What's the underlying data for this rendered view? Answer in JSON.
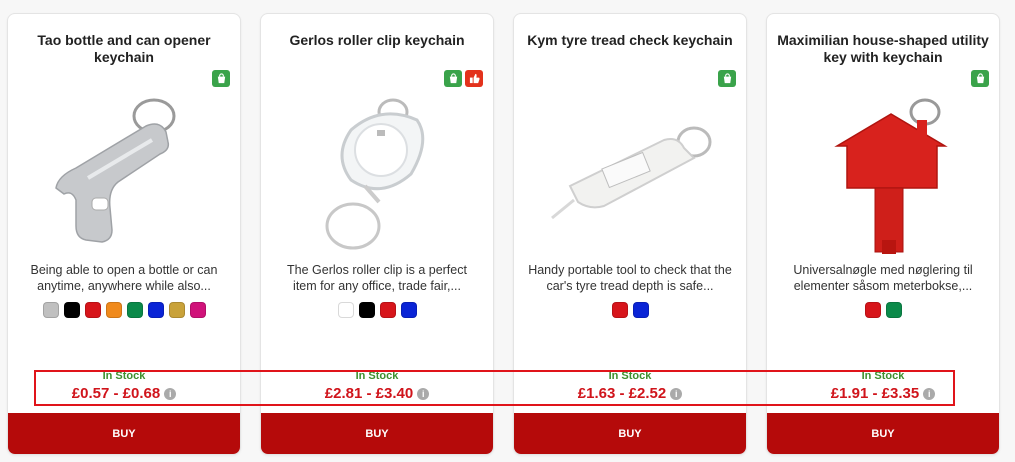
{
  "products": [
    {
      "title": "Tao bottle and can opener keychain",
      "badges": [
        "eco-bag-icon"
      ],
      "description": "Being able to open a bottle or can anytime, anywhere while also...",
      "swatches": [
        "#c0c0c0",
        "#000000",
        "#d7151b",
        "#f08a1c",
        "#0b8a4a",
        "#0a24d6",
        "#c9a23a",
        "#d0127a"
      ],
      "stock": "In Stock",
      "price": "£0.57 - £0.68",
      "buy_label": "BUY"
    },
    {
      "title": "Gerlos roller clip keychain",
      "badges": [
        "eco-bag-icon",
        "thumbs-up-icon"
      ],
      "description": "The Gerlos roller clip is a perfect item for any office, trade fair,...",
      "swatches": [
        "#ffffff",
        "#000000",
        "#d7151b",
        "#0a24d6"
      ],
      "stock": "In Stock",
      "price": "£2.81 - £3.40",
      "buy_label": "BUY"
    },
    {
      "title": "Kym tyre tread check keychain",
      "badges": [
        "eco-bag-icon"
      ],
      "description": "Handy portable tool to check that the car's tyre tread depth is safe...",
      "swatches": [
        "#d7151b",
        "#0a24d6"
      ],
      "stock": "In Stock",
      "price": "£1.63 - £2.52",
      "buy_label": "BUY"
    },
    {
      "title": "Maximilian house-shaped utility key with keychain",
      "badges": [
        "eco-bag-icon"
      ],
      "description": "Universalnøgle med nøglering til elementer såsom meterbokse,...",
      "swatches": [
        "#d7151b",
        "#0b8a4a"
      ],
      "stock": "In Stock",
      "price": "£1.91 - £3.35",
      "buy_label": "BUY"
    }
  ],
  "info_icon_glyph": "i",
  "colors": {
    "buy_button": "#b50a0a",
    "price": "#d0141b",
    "stock": "#3f8f2e",
    "highlight": "#e0141a"
  }
}
